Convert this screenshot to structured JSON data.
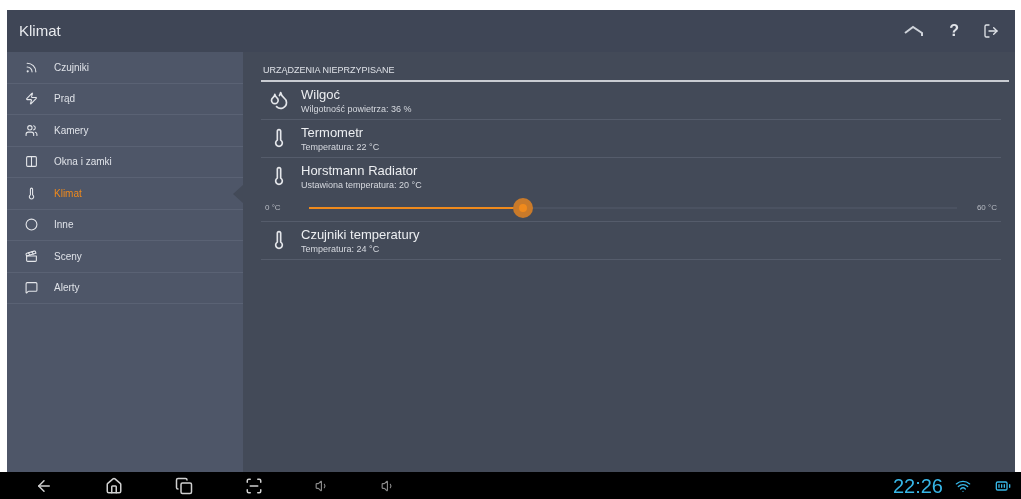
{
  "app_bar": {
    "title": "Klimat",
    "actions": [
      {
        "kind": "home"
      },
      {
        "kind": "help",
        "label": "?"
      },
      {
        "kind": "logout"
      }
    ]
  },
  "sidebar": {
    "items": [
      {
        "label": "Czujniki",
        "kind": "sensors",
        "selected": false
      },
      {
        "label": "Prąd",
        "kind": "power",
        "selected": false
      },
      {
        "label": "Kamery",
        "kind": "cameras",
        "selected": false
      },
      {
        "label": "Okna i zamki",
        "kind": "windows",
        "selected": false
      },
      {
        "label": "Klimat",
        "kind": "climate",
        "selected": true
      },
      {
        "label": "Inne",
        "kind": "other",
        "selected": false
      },
      {
        "label": "Sceny",
        "kind": "scenes",
        "selected": false
      },
      {
        "label": "Alerty",
        "kind": "alerts",
        "selected": false
      }
    ]
  },
  "section": {
    "title": "URZĄDZENIA NIEPRZYPISANE",
    "devices": [
      {
        "kind": "humidity",
        "name": "Wilgoć",
        "status": "Wilgotność powietrza: 36 %"
      },
      {
        "kind": "thermometer",
        "name": "Termometr",
        "status": "Temperatura: 22 °C"
      },
      {
        "kind": "thermometer",
        "name": "Horstmann Radiator",
        "status": "Ustawiona temperatura: 20 °C",
        "slider": {
          "min_label": "0 °C",
          "max_label": "60 °C",
          "level": 0.33
        }
      },
      {
        "kind": "thermometer",
        "name": "Czujniki temperatury",
        "status": "Temperatura: 24 °C"
      }
    ]
  },
  "nav_bar": {
    "time": "22:26"
  }
}
